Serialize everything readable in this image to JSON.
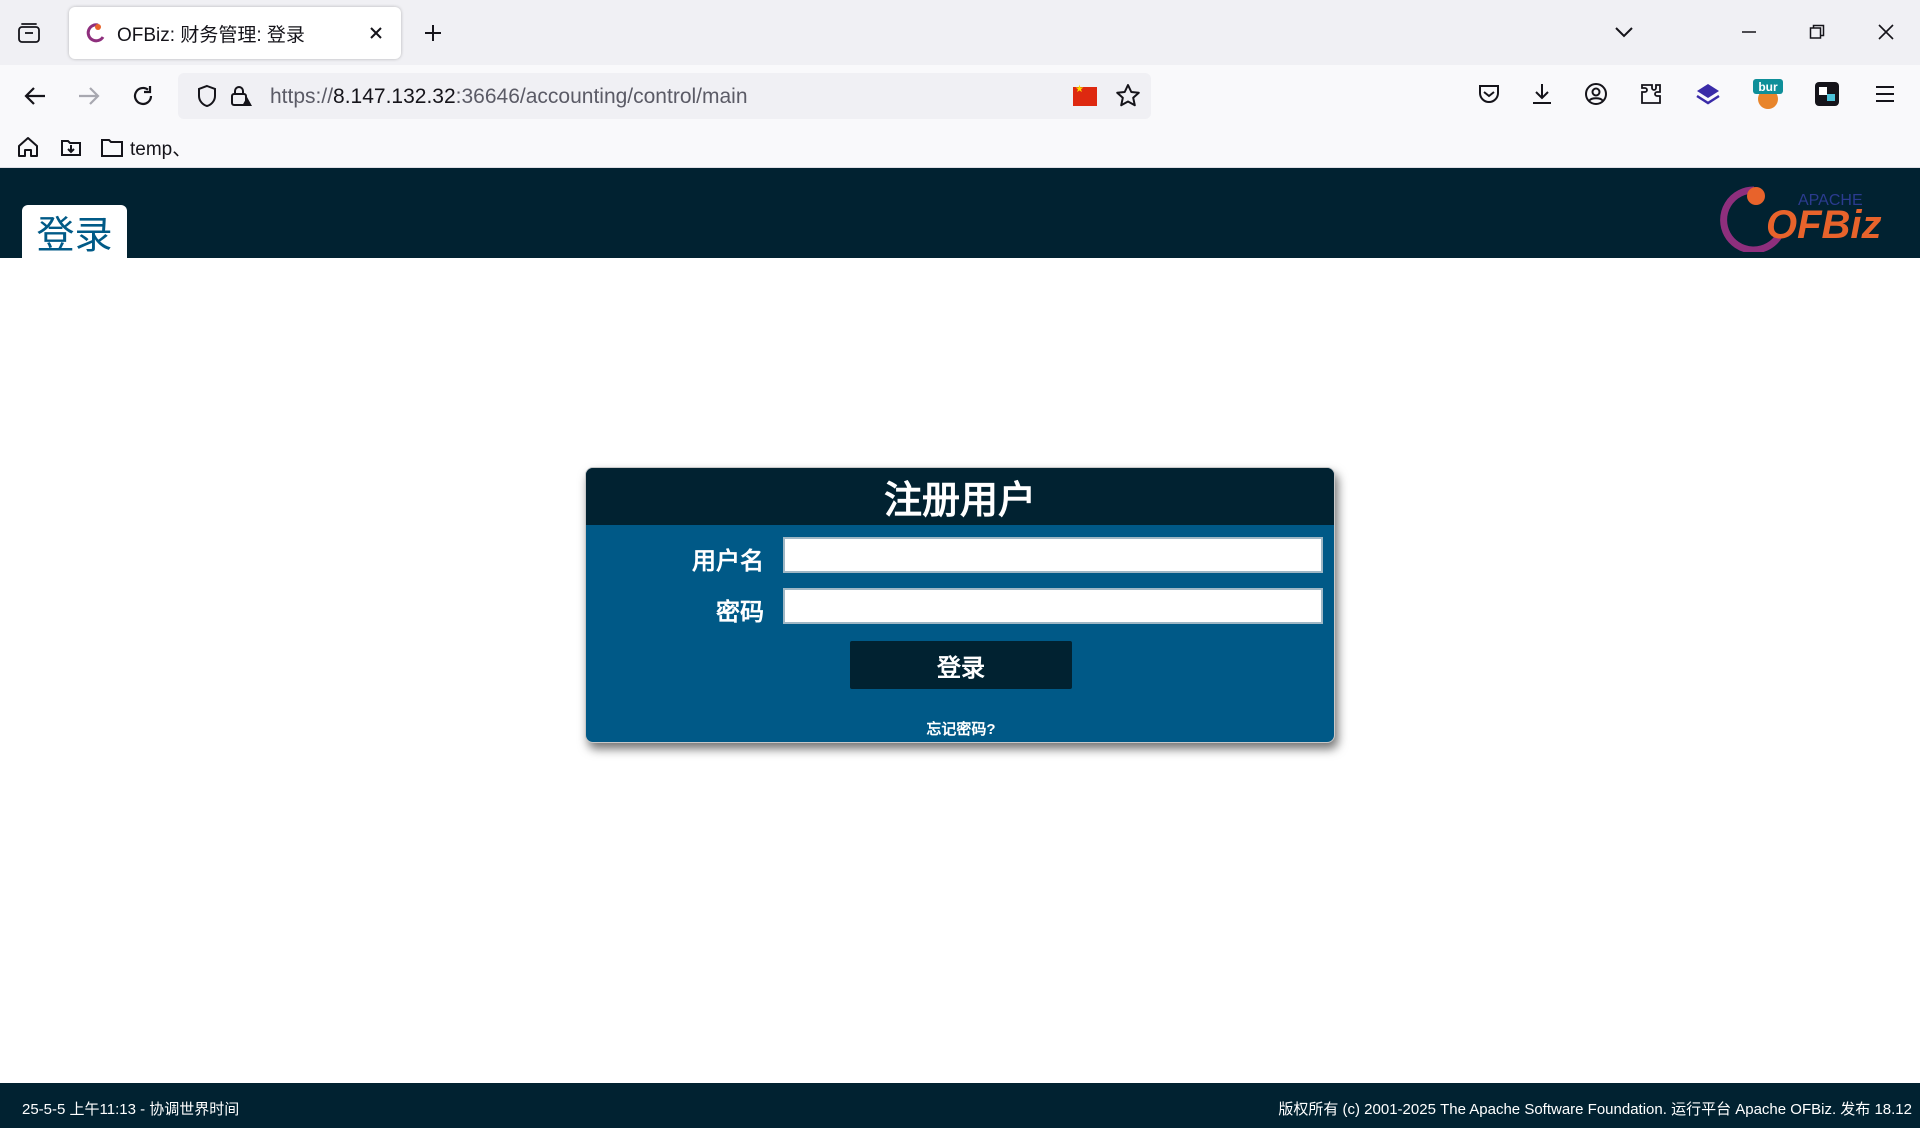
{
  "browser": {
    "tab_title": "OFBiz: 财务管理: 登录",
    "url_prefix": "https://",
    "url_host": "8.147.132.32",
    "url_rest": ":36646/accounting/control/main",
    "extension_badge": "bur",
    "bookmark_folder": "temp、"
  },
  "header": {
    "page_tab": "登录",
    "logo_top": "APACHE",
    "logo_main": "OFBiz"
  },
  "login": {
    "title": "注册用户",
    "username_label": "用户名",
    "password_label": "密码",
    "username_value": "",
    "password_value": "",
    "submit_label": "登录",
    "forgot_link": "忘记密码?"
  },
  "footer": {
    "left": "25-5-5 上午11:13 - 协调世界时间",
    "right": "版权所有 (c) 2001-2025 The Apache Software Foundation. 运行平台 Apache OFBiz. 发布 18.12"
  },
  "colors": {
    "header_bg": "#012231",
    "login_body": "#005987",
    "accent_text": "#005a87"
  }
}
